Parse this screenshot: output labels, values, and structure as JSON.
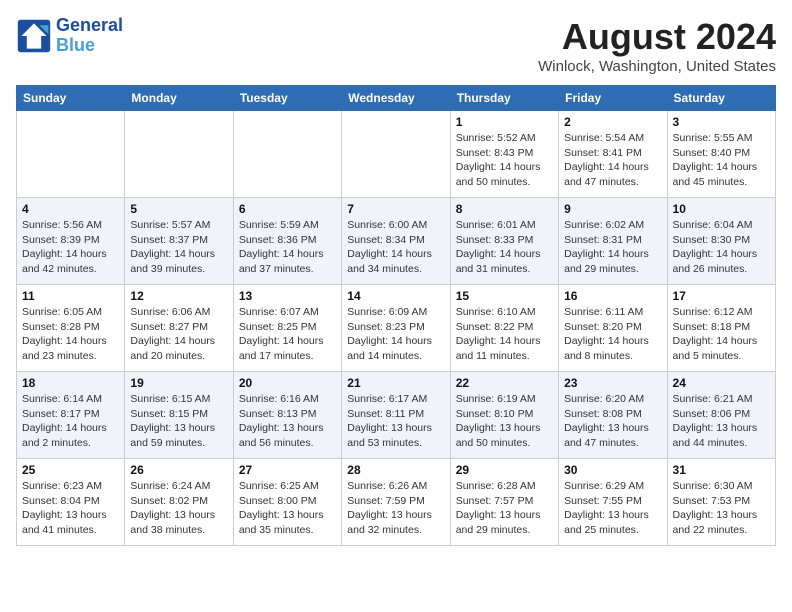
{
  "header": {
    "logo_line1": "General",
    "logo_line2": "Blue",
    "month_year": "August 2024",
    "location": "Winlock, Washington, United States"
  },
  "weekdays": [
    "Sunday",
    "Monday",
    "Tuesday",
    "Wednesday",
    "Thursday",
    "Friday",
    "Saturday"
  ],
  "weeks": [
    [
      {
        "day": "",
        "info": ""
      },
      {
        "day": "",
        "info": ""
      },
      {
        "day": "",
        "info": ""
      },
      {
        "day": "",
        "info": ""
      },
      {
        "day": "1",
        "sunrise": "5:52 AM",
        "sunset": "8:43 PM",
        "daylight": "14 hours and 50 minutes."
      },
      {
        "day": "2",
        "sunrise": "5:54 AM",
        "sunset": "8:41 PM",
        "daylight": "14 hours and 47 minutes."
      },
      {
        "day": "3",
        "sunrise": "5:55 AM",
        "sunset": "8:40 PM",
        "daylight": "14 hours and 45 minutes."
      }
    ],
    [
      {
        "day": "4",
        "sunrise": "5:56 AM",
        "sunset": "8:39 PM",
        "daylight": "14 hours and 42 minutes."
      },
      {
        "day": "5",
        "sunrise": "5:57 AM",
        "sunset": "8:37 PM",
        "daylight": "14 hours and 39 minutes."
      },
      {
        "day": "6",
        "sunrise": "5:59 AM",
        "sunset": "8:36 PM",
        "daylight": "14 hours and 37 minutes."
      },
      {
        "day": "7",
        "sunrise": "6:00 AM",
        "sunset": "8:34 PM",
        "daylight": "14 hours and 34 minutes."
      },
      {
        "day": "8",
        "sunrise": "6:01 AM",
        "sunset": "8:33 PM",
        "daylight": "14 hours and 31 minutes."
      },
      {
        "day": "9",
        "sunrise": "6:02 AM",
        "sunset": "8:31 PM",
        "daylight": "14 hours and 29 minutes."
      },
      {
        "day": "10",
        "sunrise": "6:04 AM",
        "sunset": "8:30 PM",
        "daylight": "14 hours and 26 minutes."
      }
    ],
    [
      {
        "day": "11",
        "sunrise": "6:05 AM",
        "sunset": "8:28 PM",
        "daylight": "14 hours and 23 minutes."
      },
      {
        "day": "12",
        "sunrise": "6:06 AM",
        "sunset": "8:27 PM",
        "daylight": "14 hours and 20 minutes."
      },
      {
        "day": "13",
        "sunrise": "6:07 AM",
        "sunset": "8:25 PM",
        "daylight": "14 hours and 17 minutes."
      },
      {
        "day": "14",
        "sunrise": "6:09 AM",
        "sunset": "8:23 PM",
        "daylight": "14 hours and 14 minutes."
      },
      {
        "day": "15",
        "sunrise": "6:10 AM",
        "sunset": "8:22 PM",
        "daylight": "14 hours and 11 minutes."
      },
      {
        "day": "16",
        "sunrise": "6:11 AM",
        "sunset": "8:20 PM",
        "daylight": "14 hours and 8 minutes."
      },
      {
        "day": "17",
        "sunrise": "6:12 AM",
        "sunset": "8:18 PM",
        "daylight": "14 hours and 5 minutes."
      }
    ],
    [
      {
        "day": "18",
        "sunrise": "6:14 AM",
        "sunset": "8:17 PM",
        "daylight": "14 hours and 2 minutes."
      },
      {
        "day": "19",
        "sunrise": "6:15 AM",
        "sunset": "8:15 PM",
        "daylight": "13 hours and 59 minutes."
      },
      {
        "day": "20",
        "sunrise": "6:16 AM",
        "sunset": "8:13 PM",
        "daylight": "13 hours and 56 minutes."
      },
      {
        "day": "21",
        "sunrise": "6:17 AM",
        "sunset": "8:11 PM",
        "daylight": "13 hours and 53 minutes."
      },
      {
        "day": "22",
        "sunrise": "6:19 AM",
        "sunset": "8:10 PM",
        "daylight": "13 hours and 50 minutes."
      },
      {
        "day": "23",
        "sunrise": "6:20 AM",
        "sunset": "8:08 PM",
        "daylight": "13 hours and 47 minutes."
      },
      {
        "day": "24",
        "sunrise": "6:21 AM",
        "sunset": "8:06 PM",
        "daylight": "13 hours and 44 minutes."
      }
    ],
    [
      {
        "day": "25",
        "sunrise": "6:23 AM",
        "sunset": "8:04 PM",
        "daylight": "13 hours and 41 minutes."
      },
      {
        "day": "26",
        "sunrise": "6:24 AM",
        "sunset": "8:02 PM",
        "daylight": "13 hours and 38 minutes."
      },
      {
        "day": "27",
        "sunrise": "6:25 AM",
        "sunset": "8:00 PM",
        "daylight": "13 hours and 35 minutes."
      },
      {
        "day": "28",
        "sunrise": "6:26 AM",
        "sunset": "7:59 PM",
        "daylight": "13 hours and 32 minutes."
      },
      {
        "day": "29",
        "sunrise": "6:28 AM",
        "sunset": "7:57 PM",
        "daylight": "13 hours and 29 minutes."
      },
      {
        "day": "30",
        "sunrise": "6:29 AM",
        "sunset": "7:55 PM",
        "daylight": "13 hours and 25 minutes."
      },
      {
        "day": "31",
        "sunrise": "6:30 AM",
        "sunset": "7:53 PM",
        "daylight": "13 hours and 22 minutes."
      }
    ]
  ]
}
